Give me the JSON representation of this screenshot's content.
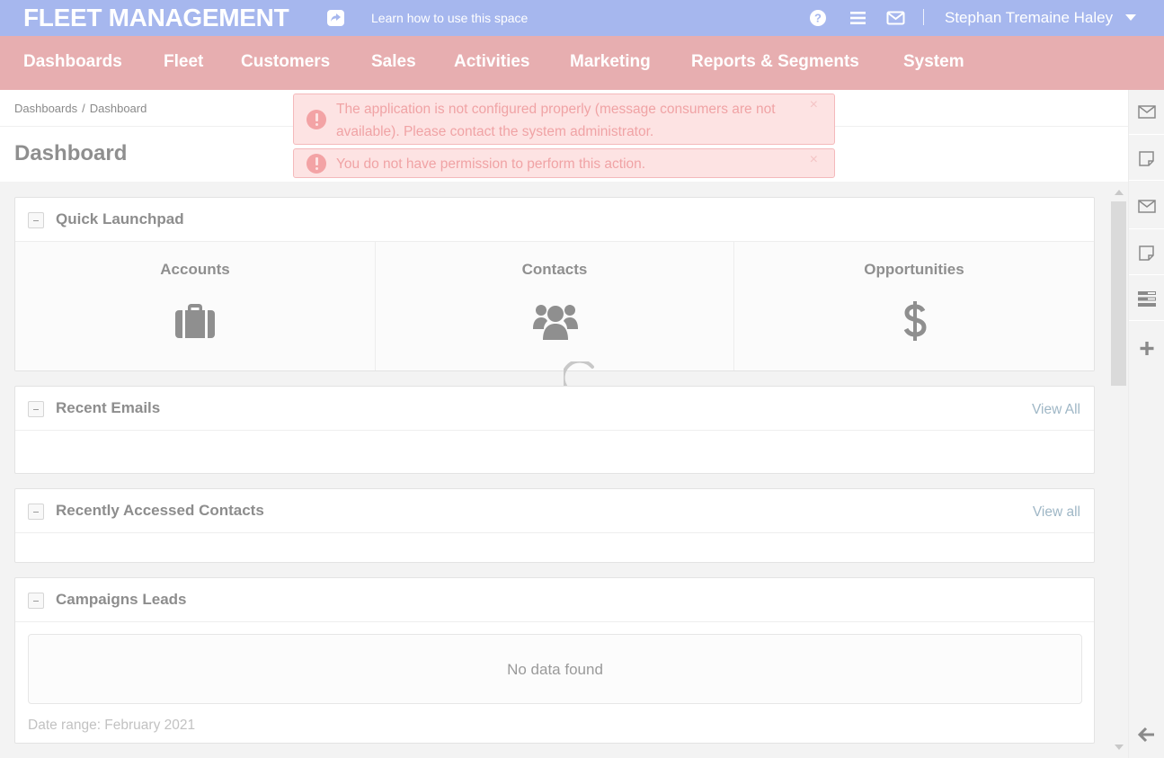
{
  "topbar": {
    "app_title": "FLEET MANAGEMENT",
    "learn_link": "Learn how to use this space",
    "user_name": "Stephan Tremaine Haley",
    "icons": [
      "share-icon",
      "help-icon",
      "menu-icon",
      "envelope-icon",
      "caret-down-icon"
    ]
  },
  "nav": {
    "items": [
      {
        "label": "Dashboards"
      },
      {
        "label": "Fleet"
      },
      {
        "label": "Customers"
      },
      {
        "label": "Sales"
      },
      {
        "label": "Activities"
      },
      {
        "label": "Marketing"
      },
      {
        "label": "Reports & Segments"
      },
      {
        "label": "System"
      }
    ]
  },
  "breadcrumb": {
    "items": [
      "Dashboards",
      "Dashboard"
    ],
    "separator": "/"
  },
  "page": {
    "title": "Dashboard"
  },
  "alerts": [
    {
      "text": "The application is not configured properly (message consumers are not available). Please contact the system administrator.",
      "close": "×"
    },
    {
      "text": "You do not have permission to perform this action.",
      "close": "×"
    }
  ],
  "widgets": {
    "launchpad": {
      "title": "Quick Launchpad",
      "items": [
        {
          "label": "Accounts",
          "icon": "briefcase-icon"
        },
        {
          "label": "Contacts",
          "icon": "users-icon"
        },
        {
          "label": "Opportunities",
          "icon": "dollar-icon"
        }
      ]
    },
    "emails": {
      "title": "Recent Emails",
      "view_all": "View All"
    },
    "contacts": {
      "title": "Recently Accessed Contacts",
      "view_all": "View all"
    },
    "campaigns": {
      "title": "Campaigns Leads",
      "no_data": "No data found",
      "date_range": "Date range: February 2021"
    }
  },
  "sidebar": {
    "items": [
      "envelope-icon",
      "note-icon",
      "envelope-icon",
      "note-icon",
      "tasks-icon",
      "plus-icon"
    ],
    "bottom": "arrow-left-icon"
  },
  "colors": {
    "topbar": "#a6b7ee",
    "nav": "#e7aeb0",
    "alert_bg": "#fde3e3",
    "alert_text": "#f0a3a5",
    "link": "#9fb7c6"
  }
}
